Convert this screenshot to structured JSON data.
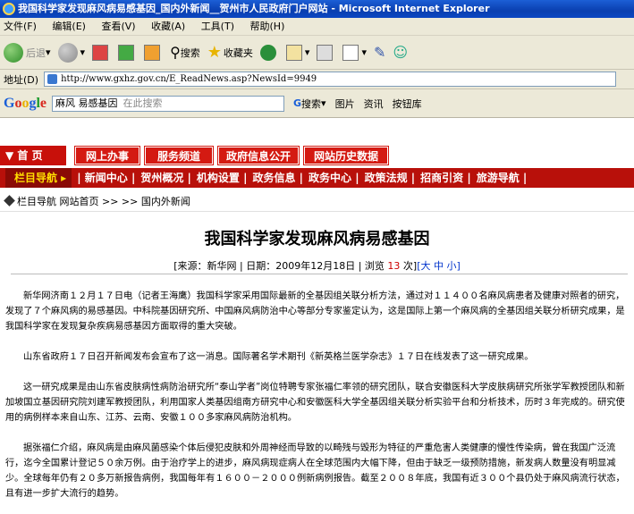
{
  "window": {
    "title": "我国科学家发现麻风病易感基因_国内外新闻__贺州市人民政府门户网站 - Microsoft Internet Explorer"
  },
  "menu": [
    "文件(F)",
    "编辑(E)",
    "查看(V)",
    "收藏(A)",
    "工具(T)",
    "帮助(H)"
  ],
  "toolbar": {
    "back": "后退",
    "search": "搜索",
    "favorites": "收藏夹"
  },
  "address": {
    "label": "地址(D)",
    "url": "http://www.gxhz.gov.cn/E_ReadNews.asp?NewsId=9949"
  },
  "google": {
    "query": "麻风 易感基因",
    "placeholder": "在此搜索",
    "search": "搜索",
    "images": "图片",
    "news": "资讯",
    "pin": "按钮库"
  },
  "nav1": {
    "home": "▼ 首  页",
    "tabs": [
      "网上办事",
      "服务频道",
      "政府信息公开",
      "网站历史数据"
    ]
  },
  "nav2": {
    "lead": "栏目导航 ▸",
    "items": [
      "| 新闻中心 |",
      "贺州概况 |",
      "机构设置 |",
      "政务信息 |",
      "政务中心 |",
      "政策法规 |",
      "招商引资 |",
      "旅游导航 |"
    ]
  },
  "breadcrumb": "栏目导航   网站首页 >> >> 国内外新闻",
  "article": {
    "title": "我国科学家发现麻风病易感基因",
    "meta_prefix": "[来源：新华网 | 日期：2009年12月18日 | 浏览",
    "views": "13",
    "meta_suffix": "次]",
    "size_links": "[大 中 小]",
    "paragraphs": [
      "新华网济南１２月１７日电（记者王海鹰）我国科学家采用国际最新的全基因组关联分析方法，通过对１１４００名麻风病患者及健康对照者的研究，发现了７个麻风病的易感基因。中科院基因研究所、中国麻风病防治中心等部分专家鉴定认为，这是国际上第一个麻风病的全基因组关联分析研究成果，是我国科学家在发现复杂疾病易感基因方面取得的重大突破。",
      "山东省政府１７日召开新闻发布会宣布了这一消息。国际著名学术期刊《新英格兰医学杂志》１７日在线发表了这一研究成果。",
      "这一研究成果是由山东省皮肤病性病防治研究所“泰山学者”岗位特聘专家张福仁率领的研究团队，联合安徽医科大学皮肤病研究所张学军教授团队和新加坡国立基因研究院刘建军教授团队，利用国家人类基因组南方研究中心和安徽医科大学全基因组关联分析实验平台和分析技术，历时３年完成的。研究使用的病例样本来自山东、江苏、云南、安徽１００多家麻风病防治机构。",
      "据张福仁介绍，麻风病是由麻风菌感染个体后侵犯皮肤和外周神经而导致的以畸残与毁形为特征的严重危害人类健康的慢性传染病，曾在我国广泛流行，迄今全国累计登记５０余万例。由于治疗学上的进步，麻风病现症病人在全球范围内大幅下降，但由于缺乏一级预防措施，新发病人数量没有明显减少。全球每年仍有２０多万新报告病例，我国每年有１６００－２０００例新病例报告。截至２００８年底，我国有近３００个县仍处于麻风病流行状态，且有进一步扩大流行的趋势。"
    ]
  }
}
